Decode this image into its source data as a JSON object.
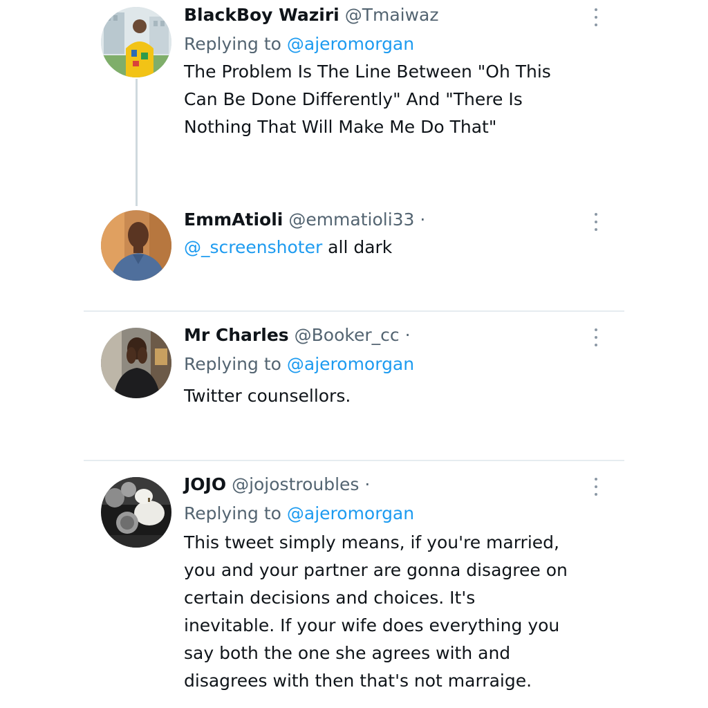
{
  "tweets": [
    {
      "display_name": "BlackBoy Waziri",
      "handle": "@Tmaiwaz",
      "separator": "",
      "replying_prefix": "Replying to",
      "replying_to": "@ajeromorgan",
      "text_lines": [
        "The Problem Is The Line Between \"Oh This",
        "Can Be Done Differently\" And \"There Is",
        "Nothing That Will Make Me Do That\""
      ],
      "avatar_icon": "avatar-yellow-shirt"
    },
    {
      "display_name": "EmmAtioli",
      "handle": "@emmatioli33",
      "separator": "·",
      "mention": "@_screenshoter",
      "text": " all dark",
      "avatar_icon": "avatar-man-smiling"
    },
    {
      "display_name": "Mr Charles",
      "handle": "@Booker_cc",
      "separator": "·",
      "replying_prefix": "Replying to",
      "replying_to": "@ajeromorgan",
      "text_lines": [
        "Twitter counsellors."
      ],
      "avatar_icon": "avatar-man-hands-face"
    },
    {
      "display_name": "JOJO",
      "handle": "@jojostroubles",
      "separator": "·",
      "replying_prefix": "Replying to",
      "replying_to": "@ajeromorgan",
      "text_lines": [
        "This tweet simply means, if you're married,",
        "you and your partner are gonna disagree on",
        "certain decisions and choices. It's",
        "inevitable. If your wife does everything you",
        "say both the one she agrees with and",
        "disagrees with then that's not marraige."
      ],
      "avatar_icon": "avatar-pumpkins"
    }
  ],
  "colors": {
    "link": "#1d9bf0",
    "secondary_text": "#536471",
    "primary_text": "#0f1419",
    "divider": "#e6ecf0",
    "thread_line": "#cfd9de"
  },
  "icons": {
    "more": "more-options-icon"
  }
}
